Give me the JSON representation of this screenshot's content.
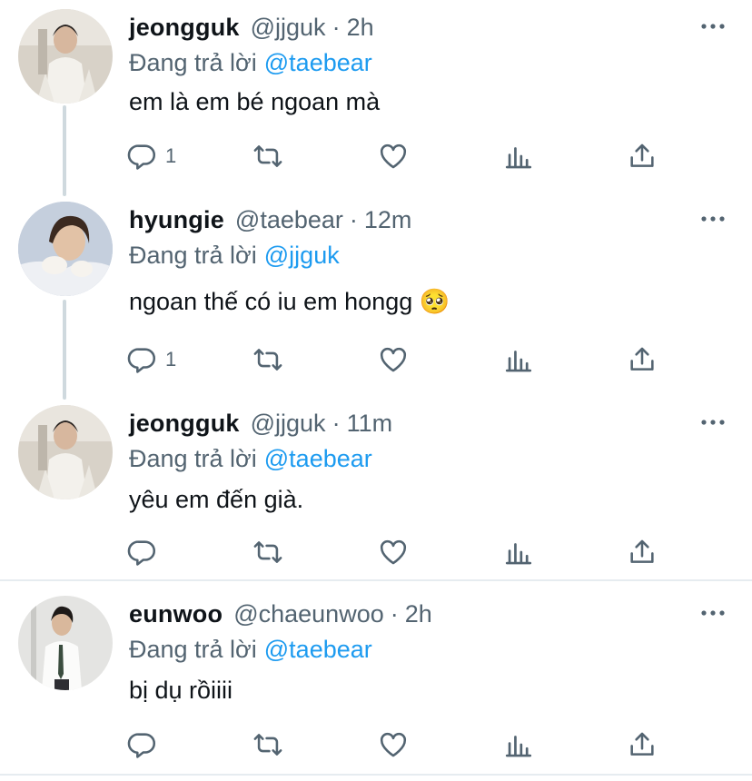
{
  "tweets": [
    {
      "name": "jeongguk",
      "handle": "@jjguk",
      "separator": "·",
      "time": "2h",
      "replying_label": "Đang trả lời",
      "replying_to": "@taebear",
      "text": "em là em bé ngoan mà",
      "reply_count": "1",
      "avatar": "avatar-jeongguk"
    },
    {
      "name": "hyungie",
      "handle": "@taebear",
      "separator": "·",
      "time": "12m",
      "replying_label": "Đang trả lời",
      "replying_to": "@jjguk",
      "text": "ngoan thế có iu em hongg 🥺",
      "reply_count": "1",
      "avatar": "avatar-hyungie"
    },
    {
      "name": "jeongguk",
      "handle": "@jjguk",
      "separator": "·",
      "time": "11m",
      "replying_label": "Đang trả lời",
      "replying_to": "@taebear",
      "text": "yêu em đến già.",
      "reply_count": "",
      "avatar": "avatar-jeongguk"
    },
    {
      "name": "eunwoo",
      "handle": "@chaeunwoo",
      "separator": "·",
      "time": "2h",
      "replying_label": "Đang trả lời",
      "replying_to": "@taebear",
      "text": "bị dụ rồiiii",
      "reply_count": "",
      "avatar": "avatar-eunwoo"
    }
  ],
  "colors": {
    "text": "#0f1419",
    "secondary": "#536471",
    "accent": "#1d9bf0",
    "thread_line": "#cfd9de",
    "divider": "#e6ecf0"
  },
  "icons": [
    "reply-icon",
    "retweet-icon",
    "like-icon",
    "analytics-icon",
    "share-icon",
    "more-icon"
  ]
}
